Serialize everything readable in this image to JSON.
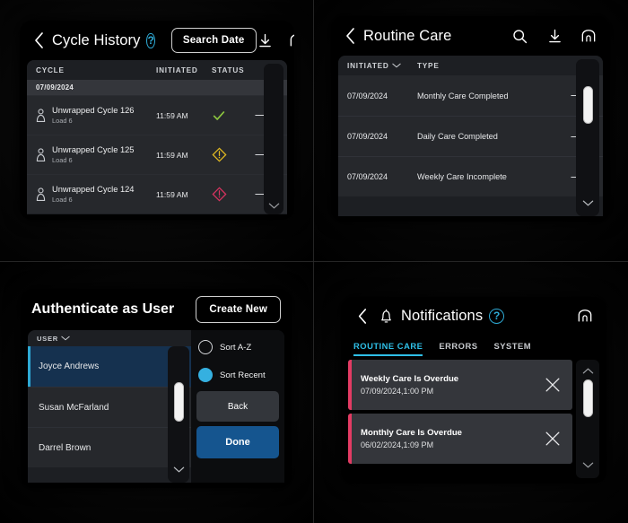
{
  "panels": {
    "cycle_history": {
      "title": "Cycle History",
      "help_label": "?",
      "search_button": "Search Date",
      "icons": {
        "back": "chevron-left-icon",
        "download": "download-icon",
        "home": "home-icon"
      },
      "columns": [
        "CYCLE",
        "INITIATED",
        "STATUS"
      ],
      "date_group": "07/09/2024",
      "rows": [
        {
          "name": "Unwrapped Cycle 126",
          "load": "Load 6",
          "initiated": "11:59 AM",
          "status": "complete"
        },
        {
          "name": "Unwrapped Cycle 125",
          "load": "Load 6",
          "initiated": "11:59 AM",
          "status": "warning"
        },
        {
          "name": "Unwrapped Cycle 124",
          "load": "Load 6",
          "initiated": "11:59 AM",
          "status": "error"
        }
      ]
    },
    "routine_care": {
      "title": "Routine Care",
      "icons": {
        "back": "chevron-left-icon",
        "search": "search-icon",
        "download": "download-icon",
        "home": "home-icon"
      },
      "columns": [
        "INITIATED",
        "TYPE"
      ],
      "rows": [
        {
          "initiated": "07/09/2024",
          "type": "Monthly Care Completed"
        },
        {
          "initiated": "07/09/2024",
          "type": "Daily Care Completed"
        },
        {
          "initiated": "07/09/2024",
          "type": "Weekly Care Incomplete"
        }
      ]
    },
    "authenticate": {
      "title": "Authenticate as User",
      "create_button": "Create New",
      "list_header": "USER",
      "users": [
        {
          "name": "Joyce Andrews",
          "selected": true
        },
        {
          "name": "Susan McFarland",
          "selected": false
        },
        {
          "name": "Darrel Brown",
          "selected": false
        }
      ],
      "sort_options": [
        {
          "label": "Sort A-Z",
          "selected": false
        },
        {
          "label": "Sort Recent",
          "selected": true
        }
      ],
      "back_button": "Back",
      "done_button": "Done"
    },
    "notifications": {
      "title": "Notifications",
      "help_label": "?",
      "icons": {
        "back": "chevron-left-icon",
        "bell": "bell-icon",
        "home": "home-icon"
      },
      "tabs": [
        {
          "label": "ROUTINE CARE",
          "active": true
        },
        {
          "label": "ERRORS",
          "active": false
        },
        {
          "label": "SYSTEM",
          "active": false
        }
      ],
      "items": [
        {
          "title": "Weekly Care Is Overdue",
          "time": "07/09/2024,1:00 PM"
        },
        {
          "title": "Monthly Care Is Overdue",
          "time": "06/02/2024,1:09 PM"
        }
      ]
    }
  },
  "colors": {
    "accent_cyan": "#2fc0e8",
    "accent_blue": "#15558f",
    "status_ok": "#8cc63f",
    "status_warn": "#e0b822",
    "status_error": "#d6335f",
    "notif_stripe": "#e33b63",
    "card_bg": "#26282c",
    "panel_bg": "#1d1f23"
  }
}
